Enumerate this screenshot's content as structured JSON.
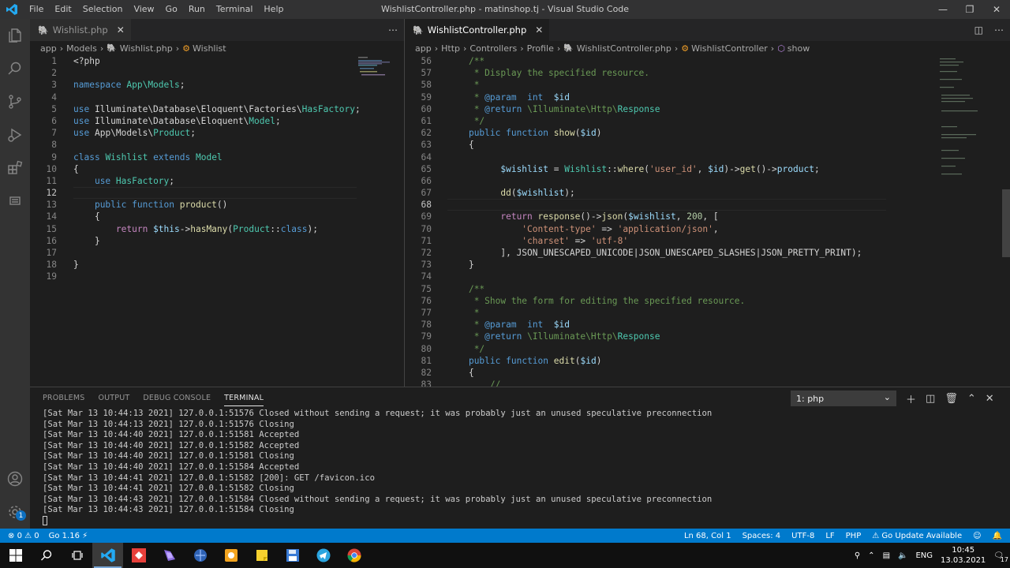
{
  "window": {
    "title": "WishlistController.php - matinshop.tj - Visual Studio Code",
    "menu": [
      "File",
      "Edit",
      "Selection",
      "View",
      "Go",
      "Run",
      "Terminal",
      "Help"
    ]
  },
  "left_editor": {
    "tab": "Wishlist.php",
    "breadcrumb": [
      "app",
      "Models",
      "Wishlist.php",
      "Wishlist"
    ],
    "lines": [
      {
        "n": "1",
        "html": "<span class='p'>&lt;?php</span>"
      },
      {
        "n": "2",
        "html": ""
      },
      {
        "n": "3",
        "html": "<span class='k'>namespace</span> <span class='t'>App\\Models</span><span class='p'>;</span>"
      },
      {
        "n": "4",
        "html": ""
      },
      {
        "n": "5",
        "html": "<span class='k'>use</span> <span class='p'>Illuminate\\Database\\Eloquent\\Factories\\</span><span class='t'>HasFactory</span><span class='p'>;</span>"
      },
      {
        "n": "6",
        "html": "<span class='k'>use</span> <span class='p'>Illuminate\\Database\\Eloquent\\</span><span class='t'>Model</span><span class='p'>;</span>"
      },
      {
        "n": "7",
        "html": "<span class='k'>use</span> <span class='p'>App\\Models\\</span><span class='t'>Product</span><span class='p'>;</span>"
      },
      {
        "n": "8",
        "html": ""
      },
      {
        "n": "9",
        "html": "<span class='k'>class</span> <span class='t'>Wishlist</span> <span class='k'>extends</span> <span class='t'>Model</span>"
      },
      {
        "n": "10",
        "html": "<span class='p'>{</span>"
      },
      {
        "n": "11",
        "html": "    <span class='k'>use</span> <span class='t'>HasFactory</span><span class='p'>;</span>"
      },
      {
        "n": "12",
        "html": ""
      },
      {
        "n": "13",
        "html": "    <span class='k'>public</span> <span class='k'>function</span> <span class='f'>product</span><span class='p'>()</span>"
      },
      {
        "n": "14",
        "html": "    <span class='p'>{</span>"
      },
      {
        "n": "15",
        "html": "        <span class='cf'>return</span> <span class='v'>$this</span><span class='p'>-&gt;</span><span class='f'>hasMany</span><span class='p'>(</span><span class='t'>Product</span><span class='p'>::</span><span class='k'>class</span><span class='p'>);</span>"
      },
      {
        "n": "16",
        "html": "    <span class='p'>}</span>"
      },
      {
        "n": "17",
        "html": ""
      },
      {
        "n": "18",
        "html": "<span class='p'>}</span>"
      },
      {
        "n": "19",
        "html": ""
      }
    ],
    "current_line": "12"
  },
  "right_editor": {
    "tab": "WishlistController.php",
    "breadcrumb": [
      "app",
      "Http",
      "Controllers",
      "Profile",
      "WishlistController.php",
      "WishlistController",
      "show"
    ],
    "lines": [
      {
        "n": "56",
        "html": "    <span class='c'>/**</span>"
      },
      {
        "n": "57",
        "html": "    <span class='c'> * Display the specified resource.</span>"
      },
      {
        "n": "58",
        "html": "    <span class='c'> *</span>"
      },
      {
        "n": "59",
        "html": "    <span class='c'> * </span><span class='k'>@param</span>  <span class='k'>int</span>  <span class='v'>$id</span>"
      },
      {
        "n": "60",
        "html": "    <span class='c'> * </span><span class='k'>@return</span> <span class='c'>\\Illuminate\\Http\\</span><span class='t'>Response</span>"
      },
      {
        "n": "61",
        "html": "    <span class='c'> */</span>"
      },
      {
        "n": "62",
        "html": "    <span class='k'>public</span> <span class='k'>function</span> <span class='f'>show</span><span class='p'>(</span><span class='v'>$id</span><span class='p'>)</span>"
      },
      {
        "n": "63",
        "html": "    <span class='p'>{</span>"
      },
      {
        "n": "64",
        "html": ""
      },
      {
        "n": "65",
        "html": "          <span class='v'>$wishlist</span> <span class='p'>=</span> <span class='t'>Wishlist</span><span class='p'>::</span><span class='f'>where</span><span class='p'>(</span><span class='s'>'user_id'</span><span class='p'>,</span> <span class='v'>$id</span><span class='p'>)-&gt;</span><span class='f'>get</span><span class='p'>()-&gt;</span><span class='v'>product</span><span class='p'>;</span>"
      },
      {
        "n": "66",
        "html": ""
      },
      {
        "n": "67",
        "html": "          <span class='f'>dd</span><span class='p'>(</span><span class='v'>$wishlist</span><span class='p'>);</span>"
      },
      {
        "n": "68",
        "html": ""
      },
      {
        "n": "69",
        "html": "          <span class='cf'>return</span> <span class='f'>response</span><span class='p'>()-&gt;</span><span class='f'>json</span><span class='p'>(</span><span class='v'>$wishlist</span><span class='p'>,</span> <span class='n'>200</span><span class='p'>, [</span>"
      },
      {
        "n": "70",
        "html": "              <span class='s'>'Content-type'</span> <span class='p'>=&gt;</span> <span class='s'>'application/json'</span><span class='p'>,</span>"
      },
      {
        "n": "71",
        "html": "              <span class='s'>'charset'</span> <span class='p'>=&gt;</span> <span class='s'>'utf-8'</span>"
      },
      {
        "n": "72",
        "html": "          <span class='p'>], JSON_UNESCAPED_UNICODE|JSON_UNESCAPED_SLASHES|JSON_PRETTY_PRINT);</span>"
      },
      {
        "n": "73",
        "html": "    <span class='p'>}</span>"
      },
      {
        "n": "74",
        "html": ""
      },
      {
        "n": "75",
        "html": "    <span class='c'>/**</span>"
      },
      {
        "n": "76",
        "html": "    <span class='c'> * Show the form for editing the specified resource.</span>"
      },
      {
        "n": "77",
        "html": "    <span class='c'> *</span>"
      },
      {
        "n": "78",
        "html": "    <span class='c'> * </span><span class='k'>@param</span>  <span class='k'>int</span>  <span class='v'>$id</span>"
      },
      {
        "n": "79",
        "html": "    <span class='c'> * </span><span class='k'>@return</span> <span class='c'>\\Illuminate\\Http\\</span><span class='t'>Response</span>"
      },
      {
        "n": "80",
        "html": "    <span class='c'> */</span>"
      },
      {
        "n": "81",
        "html": "    <span class='k'>public</span> <span class='k'>function</span> <span class='f'>edit</span><span class='p'>(</span><span class='v'>$id</span><span class='p'>)</span>"
      },
      {
        "n": "82",
        "html": "    <span class='p'>{</span>"
      },
      {
        "n": "83",
        "html": "        <span class='c'>//</span>"
      }
    ],
    "current_line": "68"
  },
  "panel": {
    "tabs": [
      "PROBLEMS",
      "OUTPUT",
      "DEBUG CONSOLE",
      "TERMINAL"
    ],
    "active_tab": "TERMINAL",
    "terminal_select": "1: php",
    "terminal_lines": [
      "[Sat Mar 13 10:44:13 2021] 127.0.0.1:51576 Closed without sending a request; it was probably just an unused speculative preconnection",
      "[Sat Mar 13 10:44:13 2021] 127.0.0.1:51576 Closing",
      "[Sat Mar 13 10:44:40 2021] 127.0.0.1:51581 Accepted",
      "[Sat Mar 13 10:44:40 2021] 127.0.0.1:51582 Accepted",
      "[Sat Mar 13 10:44:40 2021] 127.0.0.1:51581 Closing",
      "[Sat Mar 13 10:44:40 2021] 127.0.0.1:51584 Accepted",
      "[Sat Mar 13 10:44:41 2021] 127.0.0.1:51582 [200]: GET /favicon.ico",
      "[Sat Mar 13 10:44:41 2021] 127.0.0.1:51582 Closing",
      "[Sat Mar 13 10:44:43 2021] 127.0.0.1:51584 Closed without sending a request; it was probably just an unused speculative preconnection",
      "[Sat Mar 13 10:44:43 2021] 127.0.0.1:51584 Closing"
    ]
  },
  "statusbar": {
    "errors": "0",
    "warnings": "0",
    "go_version": "Go 1.16",
    "position": "Ln 68, Col 1",
    "spaces": "Spaces: 4",
    "encoding": "UTF-8",
    "eol": "LF",
    "language": "PHP",
    "go_update": "Go Update Available"
  },
  "taskbar": {
    "language": "ENG",
    "time": "10:45",
    "date": "13.03.2021",
    "notifications": "17"
  },
  "activity_badge": "1",
  "colors": {
    "accent": "#007acc",
    "editor_bg": "#1e1e1e",
    "titlebar_bg": "#323233",
    "activitybar_bg": "#333333"
  }
}
